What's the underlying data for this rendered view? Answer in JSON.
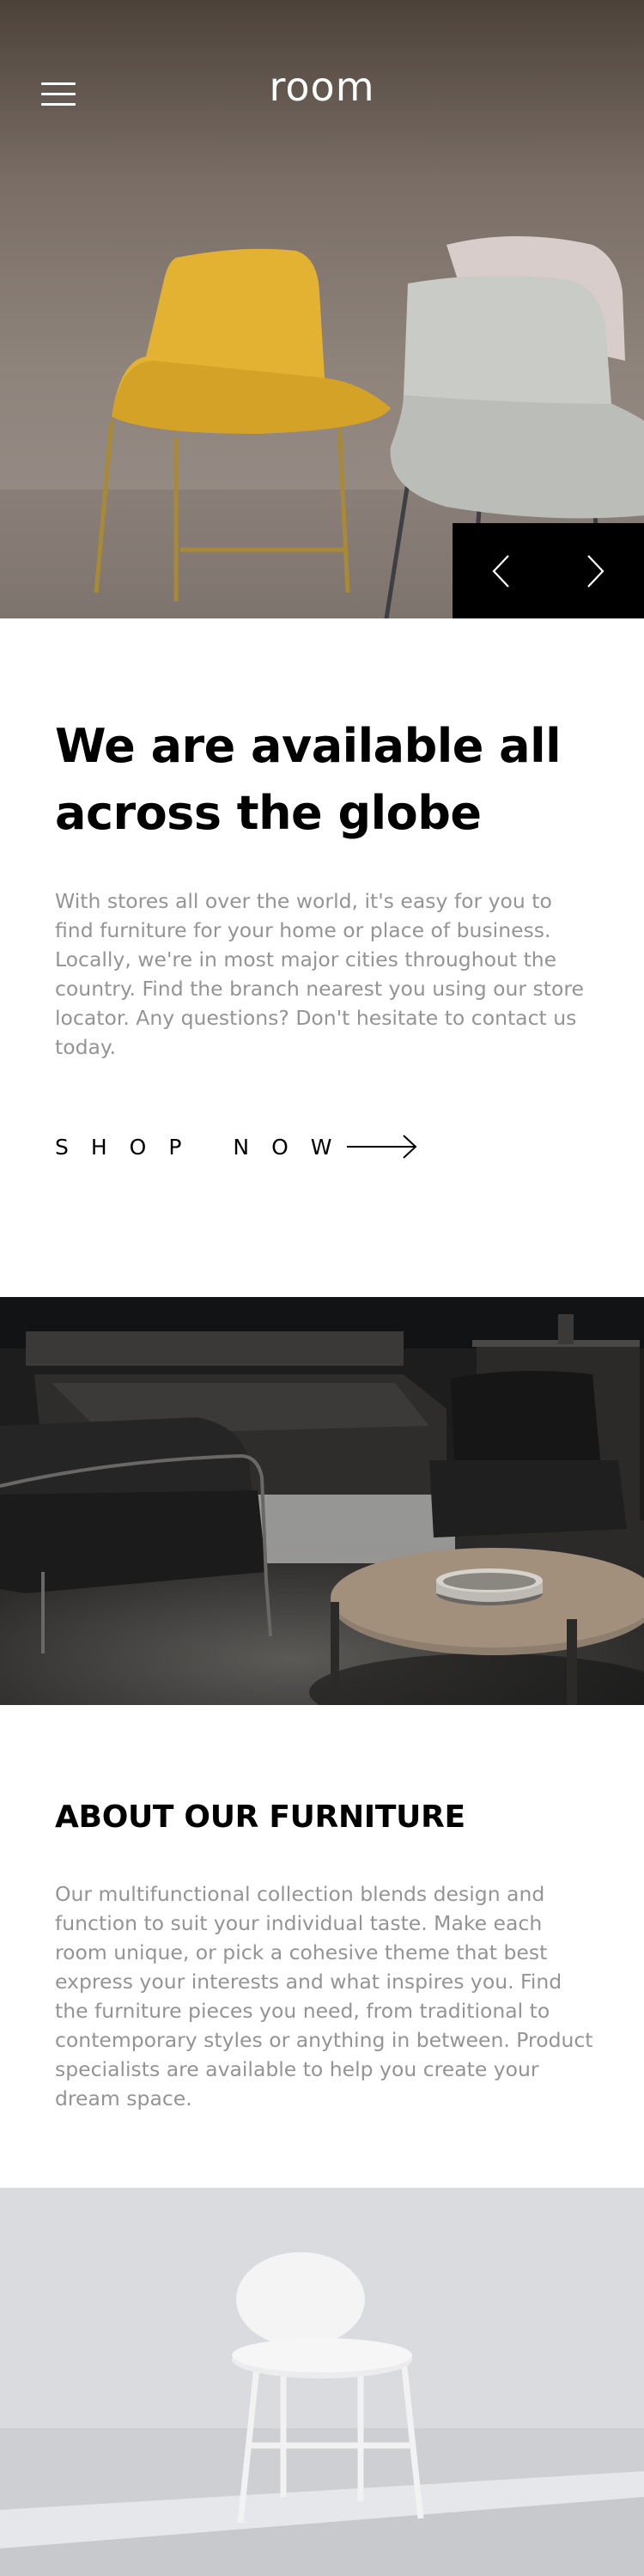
{
  "header": {
    "logo": "room",
    "menu_icon": "hamburger-menu-icon",
    "prev_icon": "chevron-left-icon",
    "next_icon": "chevron-right-icon"
  },
  "intro": {
    "heading": "We are available all across the globe",
    "body": "With stores all over the world, it's easy for you to find furniture for your home or place of business. Locally, we're in most major cities throughout the country. Find the branch nearest you using our store locator. Any questions? Don't hesitate to contact us today.",
    "cta_label": "SHOP NOW",
    "cta_icon": "arrow-right-icon"
  },
  "about": {
    "heading": "ABOUT OUR FURNITURE",
    "body": "Our multifunctional collection blends design and function to suit your individual taste. Make each room unique, or pick a cohesive theme that best express your interests and what inspires you. Find the furniture pieces you need, from traditional to contemporary styles or anything in between. Product specialists are available to help you create your dream space."
  },
  "colors": {
    "text": "#000000",
    "body_text": "#949494",
    "slider_bg": "#000000",
    "background": "#ffffff"
  }
}
